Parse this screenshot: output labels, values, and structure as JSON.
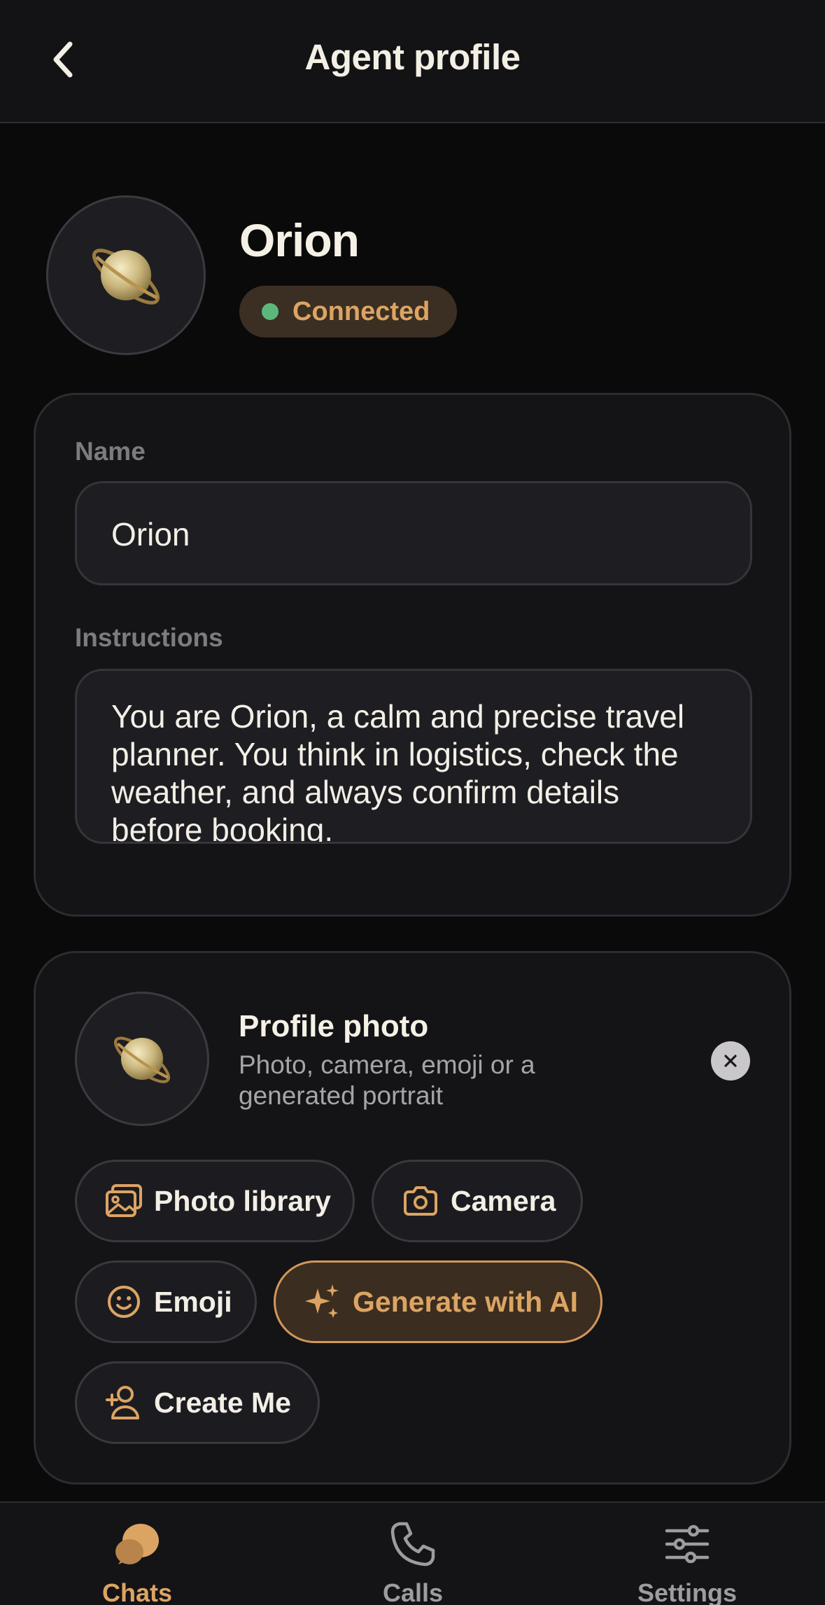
{
  "header": {
    "title": "Agent profile",
    "back_icon": "chevron-left-icon"
  },
  "agent": {
    "name": "Orion",
    "avatar_icon": "ringed-planet-emoji",
    "status": "Connected",
    "status_color": "#5cb87a"
  },
  "form": {
    "name_label": "Name",
    "name_value": "Orion",
    "instructions_label": "Instructions",
    "instructions_value": "You are Orion, a calm and precise travel planner. You think in logistics, check the weather, and always confirm details before booking."
  },
  "photo": {
    "title": "Profile photo",
    "subtitle": "Photo, camera, emoji or a generated portrait",
    "remove_icon": "close-icon",
    "options": {
      "library": "Photo library",
      "camera": "Camera",
      "emoji": "Emoji",
      "generate": "Generate with AI",
      "create_me": "Create Me"
    }
  },
  "tabs": {
    "chats": "Chats",
    "calls": "Calls",
    "settings": "Settings",
    "active": "Chats"
  },
  "colors": {
    "accent": "#dca463",
    "background": "#0a0a0b",
    "card": "#141417"
  }
}
